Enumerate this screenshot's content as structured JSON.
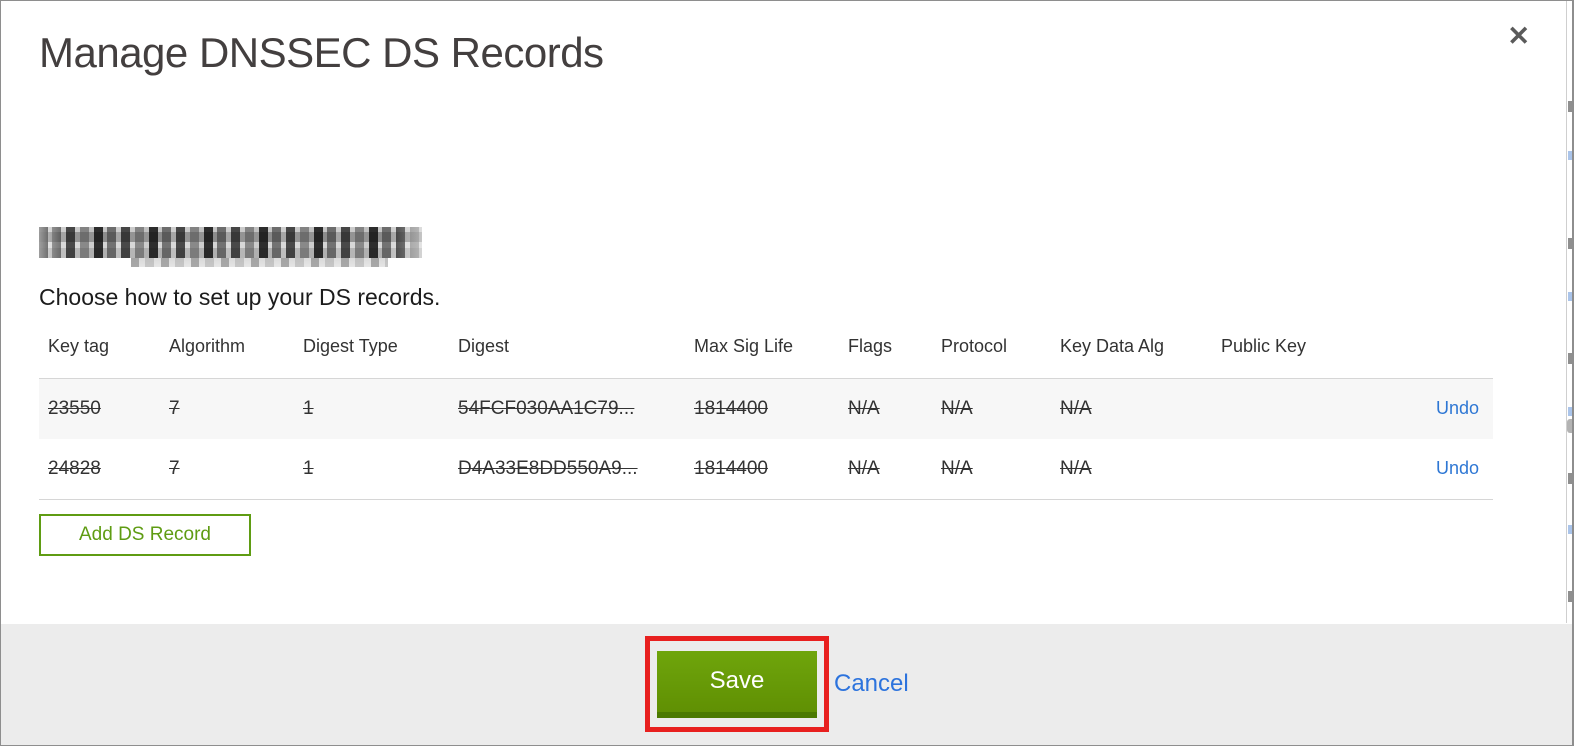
{
  "modal": {
    "title": "Manage DNSSEC DS Records",
    "icons": {
      "close": "✕"
    },
    "domain_name_redacted": true,
    "instruction": "Choose how to set up your DS records.",
    "table": {
      "columns": [
        "Key tag",
        "Algorithm",
        "Digest Type",
        "Digest",
        "Max Sig Life",
        "Flags",
        "Protocol",
        "Key Data Alg",
        "Public Key"
      ],
      "rows": [
        {
          "key_tag": "23550",
          "algorithm": "7",
          "digest_type": "1",
          "digest": "54FCF030AA1C79...",
          "max_sig_life": "1814400",
          "flags": "N/A",
          "protocol": "N/A",
          "key_data_alg": "N/A",
          "public_key": "",
          "action": "Undo",
          "state": "marked-for-deletion"
        },
        {
          "key_tag": "24828",
          "algorithm": "7",
          "digest_type": "1",
          "digest": "D4A33E8DD550A9...",
          "max_sig_life": "1814400",
          "flags": "N/A",
          "protocol": "N/A",
          "key_data_alg": "N/A",
          "public_key": "",
          "action": "Undo",
          "state": "marked-for-deletion"
        }
      ]
    },
    "add_button_label": "Add DS Record",
    "footer": {
      "save_label": "Save",
      "cancel_label": "Cancel"
    }
  },
  "colors": {
    "accent_green": "#5f9c13",
    "save_button_green": "#609003",
    "link_blue": "#2e77d4",
    "annotation_red": "#e8201f",
    "footer_gray": "#ececec",
    "row_stripe_gray": "#f7f7f7",
    "title_gray": "#433f3f"
  }
}
